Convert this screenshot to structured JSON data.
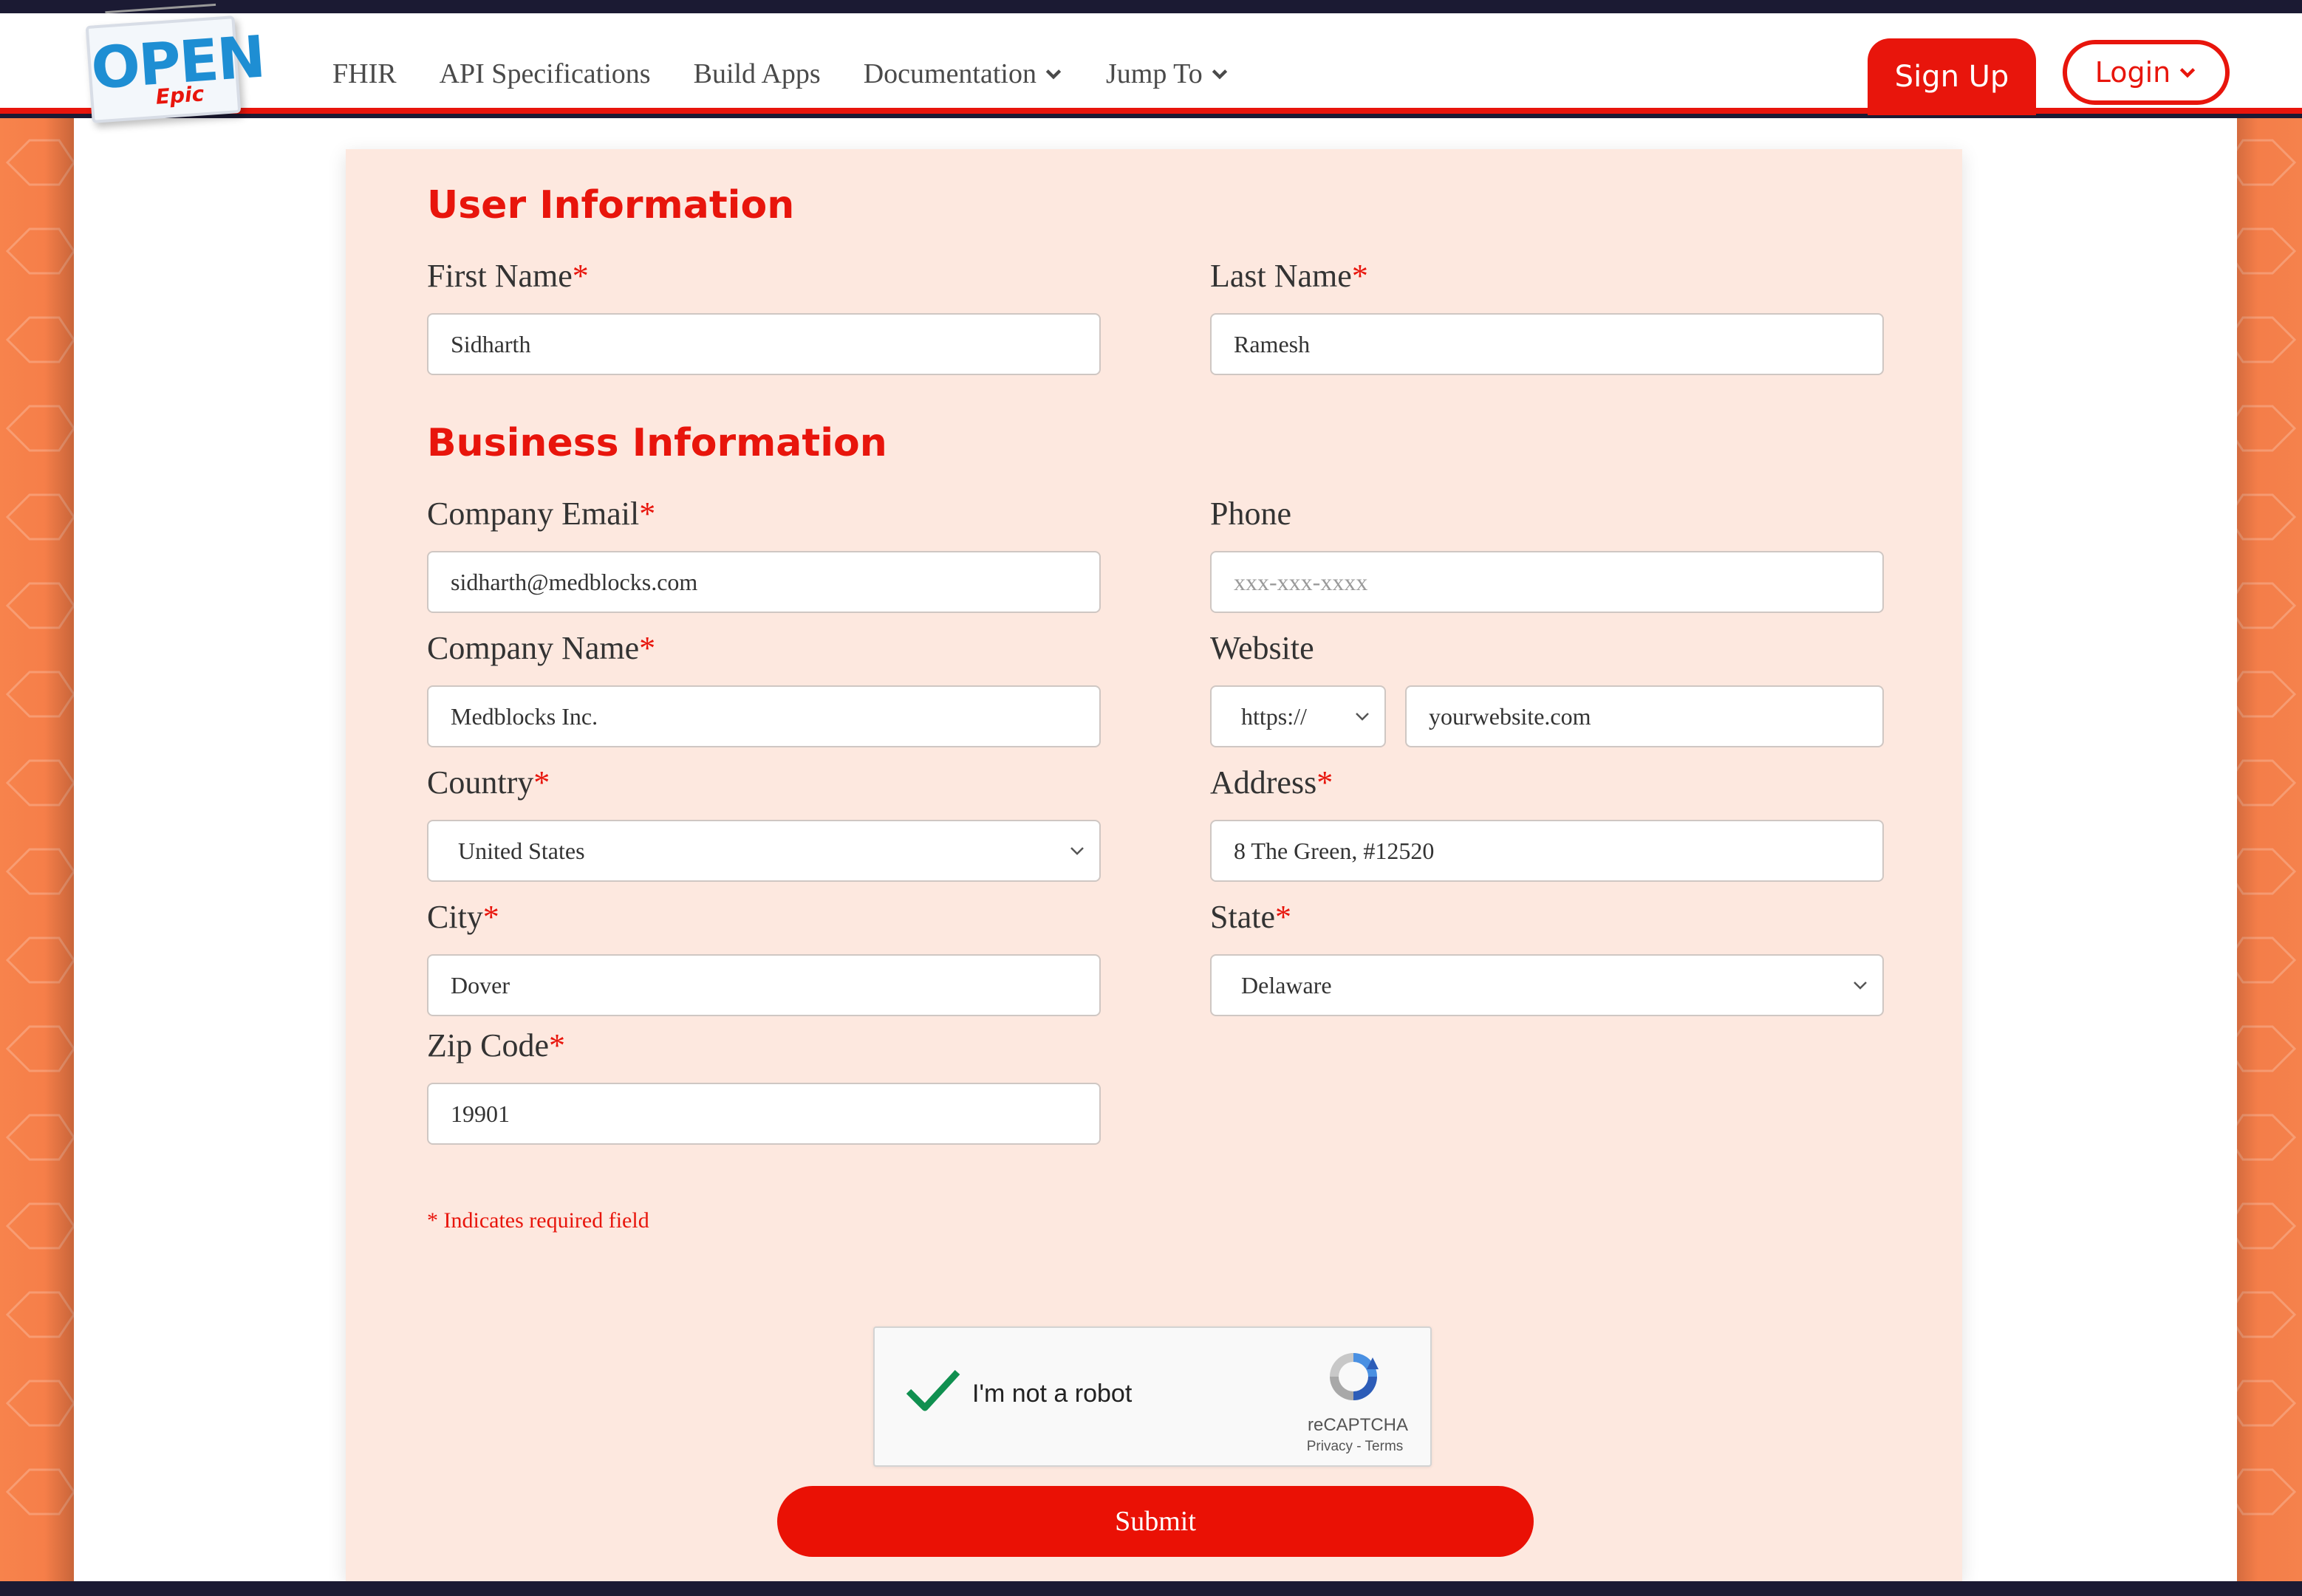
{
  "header": {
    "logo": {
      "open": "OPEN",
      "epic": "Epic"
    },
    "nav": [
      {
        "label": "FHIR",
        "dropdown": false
      },
      {
        "label": "API Specifications",
        "dropdown": false
      },
      {
        "label": "Build Apps",
        "dropdown": false
      },
      {
        "label": "Documentation",
        "dropdown": true
      },
      {
        "label": "Jump To",
        "dropdown": true
      }
    ],
    "signup_label": "Sign Up",
    "login_label": "Login"
  },
  "form": {
    "user_section_title": "User Information",
    "business_section_title": "Business Information",
    "first_name": {
      "label": "First Name",
      "value": "Sidharth"
    },
    "last_name": {
      "label": "Last Name",
      "value": "Ramesh"
    },
    "company_email": {
      "label": "Company Email",
      "value": "sidharth@medblocks.com"
    },
    "phone": {
      "label": "Phone",
      "placeholder": "xxx-xxx-xxxx"
    },
    "company_name": {
      "label": "Company Name",
      "value": "Medblocks Inc."
    },
    "website": {
      "label": "Website",
      "protocol": "https://",
      "placeholder": "yourwebsite.com"
    },
    "country": {
      "label": "Country",
      "value": "United States"
    },
    "address": {
      "label": "Address",
      "value": "8 The Green, #12520"
    },
    "city": {
      "label": "City",
      "value": "Dover"
    },
    "state": {
      "label": "State",
      "value": "Delaware"
    },
    "zip": {
      "label": "Zip Code",
      "value": "19901"
    },
    "required_marker": "*",
    "required_note": "* Indicates required field",
    "captcha": {
      "text": "I'm not a robot",
      "brand": "reCAPTCHA",
      "links": "Privacy - Terms"
    },
    "submit_label": "Submit"
  },
  "colors": {
    "accent": "#e8150c",
    "card": "#fde8df",
    "backdrop": "#ee6a3c"
  },
  "icons": [
    "chevron-down-icon",
    "checkmark-icon",
    "recaptcha-icon"
  ]
}
